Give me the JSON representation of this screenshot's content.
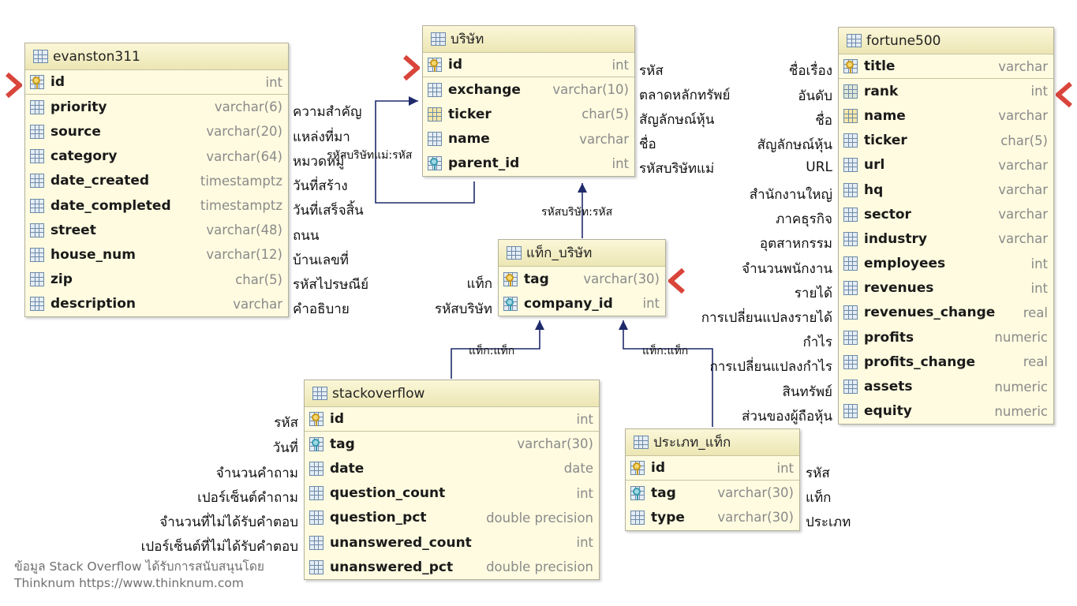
{
  "tables": {
    "evanston311": {
      "name": "evanston311",
      "columns": [
        {
          "name": "id",
          "type": "int",
          "key": "pk",
          "label": ""
        },
        {
          "name": "priority",
          "type": "varchar(6)",
          "key": "",
          "label": "ความสำคัญ"
        },
        {
          "name": "source",
          "type": "varchar(20)",
          "key": "",
          "label": "แหล่งที่มา"
        },
        {
          "name": "category",
          "type": "varchar(64)",
          "key": "",
          "label": "หมวดหมู่"
        },
        {
          "name": "date_created",
          "type": "timestamptz",
          "key": "",
          "label": "วันที่สร้าง"
        },
        {
          "name": "date_completed",
          "type": "timestamptz",
          "key": "",
          "label": "วันที่เสร็จสิ้น"
        },
        {
          "name": "street",
          "type": "varchar(48)",
          "key": "",
          "label": "ถนน"
        },
        {
          "name": "house_num",
          "type": "varchar(12)",
          "key": "",
          "label": "บ้านเลขที่"
        },
        {
          "name": "zip",
          "type": "char(5)",
          "key": "",
          "label": "รหัสไปรษณีย์"
        },
        {
          "name": "description",
          "type": "varchar",
          "key": "",
          "label": "คำอธิบาย"
        }
      ]
    },
    "company": {
      "name": "บริษัท",
      "columns": [
        {
          "name": "id",
          "type": "int",
          "key": "pk",
          "label": "รหัส"
        },
        {
          "name": "exchange",
          "type": "varchar(10)",
          "key": "",
          "label": "ตลาดหลักทรัพย์"
        },
        {
          "name": "ticker",
          "type": "char(5)",
          "key": "uk",
          "label": "สัญลักษณ์หุ้น"
        },
        {
          "name": "name",
          "type": "varchar",
          "key": "",
          "label": "ชื่อ"
        },
        {
          "name": "parent_id",
          "type": "int",
          "key": "fk",
          "label": "รหัสบริษัทแม่"
        }
      ]
    },
    "fortune500": {
      "name": "fortune500",
      "columns": [
        {
          "name": "title",
          "type": "varchar",
          "key": "pk",
          "label": "ชื่อเรื่อง"
        },
        {
          "name": "rank",
          "type": "int",
          "key": "uk",
          "label": "อันดับ"
        },
        {
          "name": "name",
          "type": "varchar",
          "key": "uk",
          "label": "ชื่อ"
        },
        {
          "name": "ticker",
          "type": "char(5)",
          "key": "",
          "label": "สัญลักษณ์หุ้น"
        },
        {
          "name": "url",
          "type": "varchar",
          "key": "",
          "label": "URL"
        },
        {
          "name": "hq",
          "type": "varchar",
          "key": "",
          "label": "สำนักงานใหญ่"
        },
        {
          "name": "sector",
          "type": "varchar",
          "key": "",
          "label": "ภาคธุรกิจ"
        },
        {
          "name": "industry",
          "type": "varchar",
          "key": "",
          "label": "อุตสาหกรรม"
        },
        {
          "name": "employees",
          "type": "int",
          "key": "",
          "label": "จำนวนพนักงาน"
        },
        {
          "name": "revenues",
          "type": "int",
          "key": "",
          "label": "รายได้"
        },
        {
          "name": "revenues_change",
          "type": "real",
          "key": "",
          "label": "การเปลี่ยนแปลงรายได้"
        },
        {
          "name": "profits",
          "type": "numeric",
          "key": "",
          "label": "กำไร"
        },
        {
          "name": "profits_change",
          "type": "real",
          "key": "",
          "label": "การเปลี่ยนแปลงกำไร"
        },
        {
          "name": "assets",
          "type": "numeric",
          "key": "",
          "label": "สินทรัพย์"
        },
        {
          "name": "equity",
          "type": "numeric",
          "key": "",
          "label": "ส่วนของผู้ถือหุ้น"
        }
      ]
    },
    "tag_company": {
      "name": "แท็ก_บริษัท",
      "columns": [
        {
          "name": "tag",
          "type": "varchar(30)",
          "key": "pk",
          "label": "แท็ก"
        },
        {
          "name": "company_id",
          "type": "int",
          "key": "pkfk",
          "label": "รหัสบริษัท"
        }
      ]
    },
    "stackoverflow": {
      "name": "stackoverflow",
      "columns": [
        {
          "name": "id",
          "type": "int",
          "key": "pk",
          "label": "รหัส"
        },
        {
          "name": "tag",
          "type": "varchar(30)",
          "key": "fk",
          "label": "วันที่"
        },
        {
          "name": "date",
          "type": "date",
          "key": "",
          "label": "จำนวนคำถาม"
        },
        {
          "name": "question_count",
          "type": "int",
          "key": "",
          "label": "เปอร์เซ็นต์คำถาม"
        },
        {
          "name": "question_pct",
          "type": "double precision",
          "key": "",
          "label": "จำนวนที่ไม่ได้รับคำตอบ"
        },
        {
          "name": "unanswered_count",
          "type": "int",
          "key": "",
          "label": "เปอร์เซ็นต์ที่ไม่ได้รับคำตอบ"
        },
        {
          "name": "unanswered_pct",
          "type": "double precision",
          "key": "",
          "label": ""
        }
      ]
    },
    "tag_type": {
      "name": "ประเภท_แท็ก",
      "columns": [
        {
          "name": "id",
          "type": "int",
          "key": "pk",
          "label": "รหัส"
        },
        {
          "name": "tag",
          "type": "varchar(30)",
          "key": "fk",
          "label": "แท็ก"
        },
        {
          "name": "type",
          "type": "varchar(30)",
          "key": "",
          "label": "ประเภท"
        }
      ]
    }
  },
  "edge_labels": {
    "company_parent": "รหัสบริษัทแม่:รหัส",
    "tag_company_to_company": "รหัสบริษัท:รหัส",
    "stackoverflow_to_tag_company": "แท็ก:แท็ก",
    "tag_type_to_tag_company": "แท็ก:แท็ก"
  },
  "credit": {
    "line1": "ข้อมูล Stack Overflow ได้รับการสนับสนุนโดย",
    "line2": "Thinknum https://www.thinknum.com"
  },
  "colors": {
    "table_fill": "#fefbe0",
    "header_fill": "#f1ecc0",
    "edge": "#1f2a6b",
    "chevron": "#d9453a",
    "type_text": "#8a8a8a"
  }
}
